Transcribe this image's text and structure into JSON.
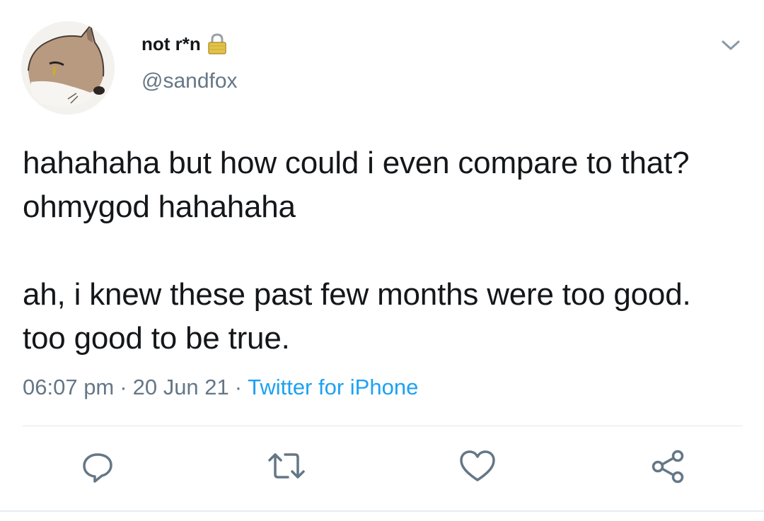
{
  "user": {
    "display_name": "not r*n",
    "handle": "@sandfox",
    "protected": true
  },
  "tweet": {
    "paragraph_1": "hahahaha but how could i even compare to that? ohmygod hahahaha",
    "paragraph_2": "ah, i knew these past few months were too good. too good to be true.",
    "time": "06:07 pm",
    "date": "20 Jun 21",
    "source": "Twitter for iPhone",
    "separator": "·"
  },
  "actions": [
    "reply-icon",
    "retweet-icon",
    "like-icon",
    "share-icon"
  ],
  "colors": {
    "text": "#14171a",
    "secondary": "#657786",
    "link": "#1da1f2",
    "divider": "#e1e8ed"
  }
}
